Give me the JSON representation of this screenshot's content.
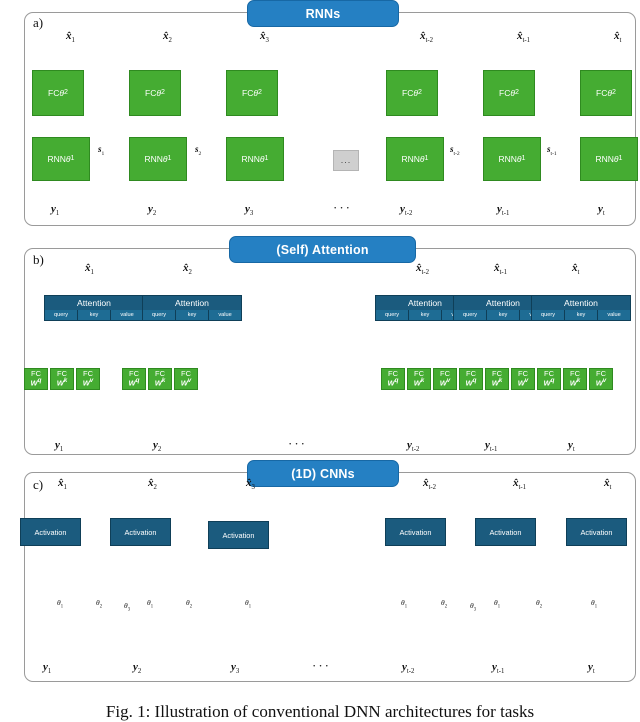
{
  "figure": {
    "caption": "Fig. 1: Illustration of conventional DNN architectures for tasks",
    "colors": {
      "banner_blue": "#2580c3",
      "green_box": "#45ac32",
      "teal_box": "#1b5b7e",
      "arrow_green": "#35c48a",
      "arrow_purple": "#7b4fc9",
      "arrow_orange": "#e07a3f",
      "arrow_black": "#1a1a1a",
      "panel_border": "#9a9a9a"
    }
  },
  "panels": [
    {
      "letter": "a)",
      "banner": "RNNs",
      "outputs": [
        "x̂1",
        "x̂2",
        "x̂3",
        "x̂t-2",
        "x̂t-1",
        "x̂t"
      ],
      "inputs": [
        "y1",
        "y2",
        "y3",
        "yt-2",
        "yt-1",
        "yt"
      ],
      "top_row_label": "FC",
      "top_row_param": "θ2",
      "bottom_row_label": "RNN",
      "bottom_row_param": "θ1",
      "state_labels": [
        "s1",
        "s2",
        "st-2",
        "st-1"
      ],
      "gap_marker": "..."
    },
    {
      "letter": "b)",
      "banner": "(Self) Attention",
      "outputs": [
        "x̂1",
        "x̂2",
        "x̂t-2",
        "x̂t-1",
        "x̂t"
      ],
      "inputs": [
        "y1",
        "y2",
        "yt-2",
        "yt-1",
        "yt"
      ],
      "attention_label": "Attention",
      "attention_ports": [
        "query",
        "key",
        "value"
      ],
      "fc_label": "FC",
      "fc_weights": [
        "Wᵠ",
        "Wᵏ",
        "Wᵛ"
      ],
      "gap_marker": "..."
    },
    {
      "letter": "c)",
      "banner": "(1D) CNNs",
      "outputs": [
        "x̂1",
        "x̂2",
        "x̂3",
        "x̂t-2",
        "x̂t-1",
        "x̂t"
      ],
      "inputs": [
        "y1",
        "y2",
        "y3",
        "yt-2",
        "yt-1",
        "yt"
      ],
      "activation_label": "Activation",
      "kernel_labels": [
        "θ1",
        "θ2",
        "θ3"
      ],
      "gap_marker": "..."
    }
  ]
}
